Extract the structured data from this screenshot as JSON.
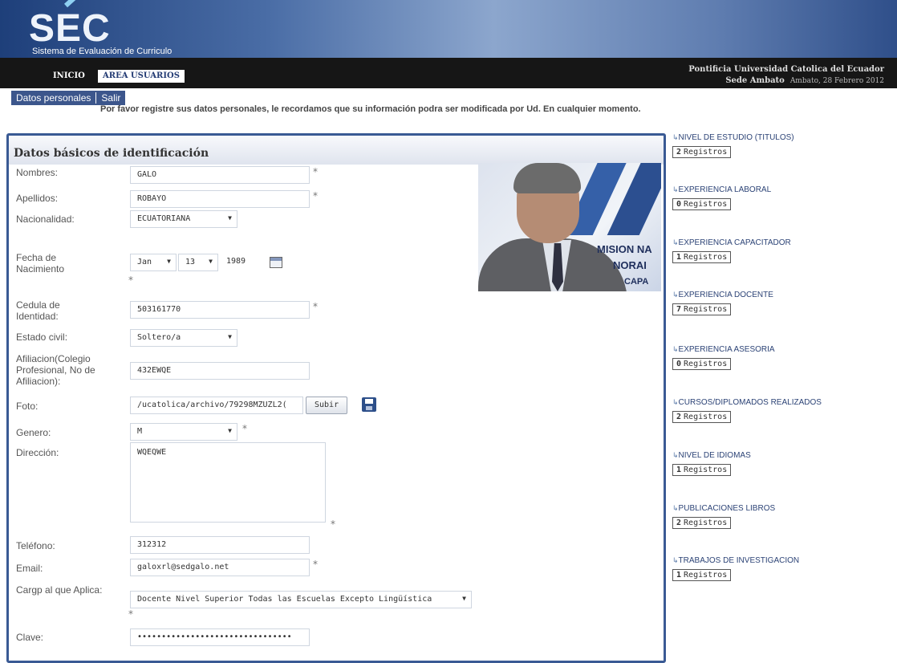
{
  "header": {
    "logo": "SEC",
    "subtitle": "Sistema de Evaluación de Curriculo",
    "nav": [
      {
        "label": "INICIO"
      },
      {
        "label": "AREA USUARIOS"
      }
    ],
    "institution": "Pontificia Universidad Catolica del Ecuador",
    "location": "Sede Ambato",
    "date": "Ambato, 28 Febrero 2012"
  },
  "subnav": {
    "items": [
      {
        "label": "Datos personales"
      },
      {
        "label": "Salir"
      }
    ]
  },
  "notice": "Por favor registre sus datos personales, le recordamos que su información podra ser modificada por Ud. En cualquier momento.",
  "form": {
    "title": "Datos básicos de identificación",
    "required_mark": "*",
    "nombres": {
      "label": "Nombres:",
      "value": "GALO"
    },
    "apellidos": {
      "label": "Apellidos:",
      "value": "ROBAYO"
    },
    "nacionalidad": {
      "label": "Nacionalidad:",
      "value": "ECUATORIANA"
    },
    "fecha": {
      "label": "Fecha de Nacimiento",
      "month": "Jan",
      "day": "13",
      "year": "1989"
    },
    "cedula": {
      "label": "Cedula de Identidad:",
      "value": "503161770"
    },
    "estado_civil": {
      "label": "Estado civil:",
      "value": "Soltero/a"
    },
    "afiliacion": {
      "label": "Afiliacion(Colegio Profesional, No de Afiliacion):",
      "value": "432EWQE"
    },
    "foto": {
      "label": "Foto:",
      "value": "/ucatolica/archivo/79298MZUZL2(",
      "button": "Subir"
    },
    "genero": {
      "label": "Genero:",
      "value": "M"
    },
    "direccion": {
      "label": "Dirección:",
      "value": "WQEQWE"
    },
    "telefono": {
      "label": "Teléfono:",
      "value": "312312"
    },
    "email": {
      "label": "Email:",
      "value": "galoxrl@sedgalo.net"
    },
    "cargo": {
      "label": "Cargp al que Aplica:",
      "value": "Docente Nivel Superior Todas las Escuelas Excepto Lingüística"
    },
    "clave": {
      "label": "Clave:",
      "value": "••••••••••••••••••••••••••••••••"
    },
    "photo_caption": [
      "MISION NA",
      "NORAI",
      "CAPA"
    ]
  },
  "sidebar": {
    "items": [
      {
        "title": "NIVEL DE ESTUDIO (Titulos)",
        "count": "2",
        "suffix": "Registros"
      },
      {
        "title": "EXPERIENCIA LABORAL",
        "count": "0",
        "suffix": "Registros"
      },
      {
        "title": "EXPERIENCIA CAPACITADOR",
        "count": "1",
        "suffix": "Registros"
      },
      {
        "title": "EXPERIENCIA DOCENTE",
        "count": "7",
        "suffix": "Registros"
      },
      {
        "title": "EXPERIENCIA ASESORIA",
        "count": "0",
        "suffix": "Registros"
      },
      {
        "title": "CURSOS/DIPLOMADOS REALIZADOS",
        "count": "2",
        "suffix": "Registros"
      },
      {
        "title": "NIVEL DE IDIOMAS",
        "count": "1",
        "suffix": "Registros"
      },
      {
        "title": "PUBLICACIONES LIBROS",
        "count": "2",
        "suffix": "Registros"
      },
      {
        "title": "TRABAJOS DE INVESTIGACION",
        "count": "1",
        "suffix": "Registros"
      }
    ]
  }
}
